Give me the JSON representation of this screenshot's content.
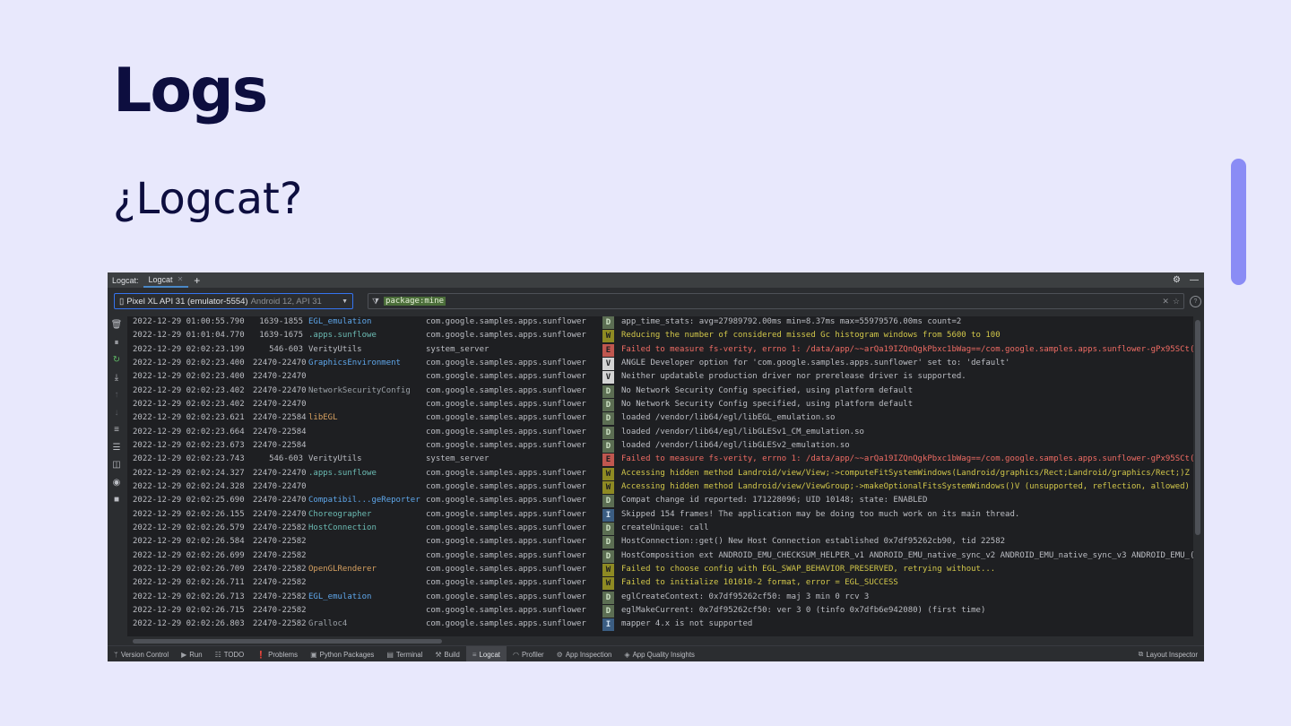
{
  "slide": {
    "title": "Logs",
    "subtitle": "¿Logcat?"
  },
  "ide": {
    "tabbar": {
      "label": "Logcat:",
      "tab": "Logcat",
      "add": "+",
      "settings_icon": "gear-icon",
      "minimize_icon": "minimize-icon"
    },
    "device": {
      "name": "Pixel XL API 31 (emulator-5554)",
      "detail": "Android 12, API 31"
    },
    "filter": {
      "query": "package:mine"
    },
    "side_toolbar": [
      {
        "name": "clear-logcat-icon",
        "glyph": "🗑"
      },
      {
        "name": "pause-icon",
        "glyph": "⏸"
      },
      {
        "name": "restart-icon",
        "glyph": "↻"
      },
      {
        "name": "scroll-to-end-icon",
        "glyph": "⤓"
      },
      {
        "name": "previous-occurrence-icon",
        "glyph": "↑"
      },
      {
        "name": "next-occurrence-icon",
        "glyph": "↓"
      },
      {
        "name": "soft-wrap-icon",
        "glyph": "≡"
      },
      {
        "name": "configure-view-icon",
        "glyph": "☰"
      },
      {
        "name": "split-panels-icon",
        "glyph": "◫"
      },
      {
        "name": "screenshot-icon",
        "glyph": "◉"
      },
      {
        "name": "screen-record-icon",
        "glyph": "■"
      }
    ],
    "log_rows": [
      {
        "time": "2022-12-29 01:00:55.790",
        "pid": "1639-1855",
        "tag": "EGL_emulation",
        "tag_style": "blue",
        "pkg": "com.google.samples.apps.sunflower",
        "level": "D",
        "msg": "app_time_stats: avg=27989792.00ms min=8.37ms max=55979576.00ms count=2"
      },
      {
        "time": "2022-12-29 01:01:04.770",
        "pid": "1639-1675",
        "tag": ".apps.sunflowe",
        "tag_style": "teal",
        "pkg": "com.google.samples.apps.sunflower",
        "level": "W",
        "msg": "Reducing the number of considered missed Gc histogram windows from 5600 to 100"
      },
      {
        "time": "2022-12-29 02:02:23.199",
        "pid": "546-603",
        "tag": "VerityUtils",
        "tag_style": "plain",
        "pkg": "system_server",
        "level": "E",
        "msg": "Failed to measure fs-verity, errno 1: /data/app/~~arQa19IZQnQgkPbxc1bWag==/com.google.samples.apps.sunflower-gPx95SCt("
      },
      {
        "time": "2022-12-29 02:02:23.400",
        "pid": "22470-22470",
        "tag": "GraphicsEnvironment",
        "tag_style": "blue",
        "pkg": "com.google.samples.apps.sunflower",
        "level": "V",
        "msg": "ANGLE Developer option for 'com.google.samples.apps.sunflower' set to: 'default'"
      },
      {
        "time": "2022-12-29 02:02:23.400",
        "pid": "22470-22470",
        "tag": "",
        "tag_style": "plain",
        "pkg": "com.google.samples.apps.sunflower",
        "level": "V",
        "msg": "Neither updatable production driver nor prerelease driver is supported."
      },
      {
        "time": "2022-12-29 02:02:23.402",
        "pid": "22470-22470",
        "tag": "NetworkSecurityConfig",
        "tag_style": "gray",
        "pkg": "com.google.samples.apps.sunflower",
        "level": "D",
        "msg": "No Network Security Config specified, using platform default"
      },
      {
        "time": "2022-12-29 02:02:23.402",
        "pid": "22470-22470",
        "tag": "",
        "tag_style": "plain",
        "pkg": "com.google.samples.apps.sunflower",
        "level": "D",
        "msg": "No Network Security Config specified, using platform default"
      },
      {
        "time": "2022-12-29 02:02:23.621",
        "pid": "22470-22584",
        "tag": "libEGL",
        "tag_style": "orange",
        "pkg": "com.google.samples.apps.sunflower",
        "level": "D",
        "msg": "loaded /vendor/lib64/egl/libEGL_emulation.so"
      },
      {
        "time": "2022-12-29 02:02:23.664",
        "pid": "22470-22584",
        "tag": "",
        "tag_style": "plain",
        "pkg": "com.google.samples.apps.sunflower",
        "level": "D",
        "msg": "loaded /vendor/lib64/egl/libGLESv1_CM_emulation.so"
      },
      {
        "time": "2022-12-29 02:02:23.673",
        "pid": "22470-22584",
        "tag": "",
        "tag_style": "plain",
        "pkg": "com.google.samples.apps.sunflower",
        "level": "D",
        "msg": "loaded /vendor/lib64/egl/libGLESv2_emulation.so"
      },
      {
        "time": "2022-12-29 02:02:23.743",
        "pid": "546-603",
        "tag": "VerityUtils",
        "tag_style": "plain",
        "pkg": "system_server",
        "level": "E",
        "msg": "Failed to measure fs-verity, errno 1: /data/app/~~arQa19IZQnQgkPbxc1bWag==/com.google.samples.apps.sunflower-gPx95SCt("
      },
      {
        "time": "2022-12-29 02:02:24.327",
        "pid": "22470-22470",
        "tag": ".apps.sunflowe",
        "tag_style": "teal",
        "pkg": "com.google.samples.apps.sunflower",
        "level": "W",
        "msg": "Accessing hidden method Landroid/view/View;->computeFitSystemWindows(Landroid/graphics/Rect;Landroid/graphics/Rect;)Z"
      },
      {
        "time": "2022-12-29 02:02:24.328",
        "pid": "22470-22470",
        "tag": "",
        "tag_style": "plain",
        "pkg": "com.google.samples.apps.sunflower",
        "level": "W",
        "msg": "Accessing hidden method Landroid/view/ViewGroup;->makeOptionalFitsSystemWindows()V (unsupported, reflection, allowed)"
      },
      {
        "time": "2022-12-29 02:02:25.690",
        "pid": "22470-22470",
        "tag": "Compatibil...geReporter",
        "tag_style": "blue",
        "pkg": "com.google.samples.apps.sunflower",
        "level": "D",
        "msg": "Compat change id reported: 171228096; UID 10148; state: ENABLED"
      },
      {
        "time": "2022-12-29 02:02:26.155",
        "pid": "22470-22470",
        "tag": "Choreographer",
        "tag_style": "teal",
        "pkg": "com.google.samples.apps.sunflower",
        "level": "I",
        "msg": "Skipped 154 frames!  The application may be doing too much work on its main thread."
      },
      {
        "time": "2022-12-29 02:02:26.579",
        "pid": "22470-22582",
        "tag": "HostConnection",
        "tag_style": "teal",
        "pkg": "com.google.samples.apps.sunflower",
        "level": "D",
        "msg": "createUnique: call"
      },
      {
        "time": "2022-12-29 02:02:26.584",
        "pid": "22470-22582",
        "tag": "",
        "tag_style": "plain",
        "pkg": "com.google.samples.apps.sunflower",
        "level": "D",
        "msg": "HostConnection::get() New Host Connection established 0x7df95262cb90, tid 22582"
      },
      {
        "time": "2022-12-29 02:02:26.699",
        "pid": "22470-22582",
        "tag": "",
        "tag_style": "plain",
        "pkg": "com.google.samples.apps.sunflower",
        "level": "D",
        "msg": "HostComposition ext ANDROID_EMU_CHECKSUM_HELPER_v1 ANDROID_EMU_native_sync_v2 ANDROID_EMU_native_sync_v3 ANDROID_EMU_("
      },
      {
        "time": "2022-12-29 02:02:26.709",
        "pid": "22470-22582",
        "tag": "OpenGLRenderer",
        "tag_style": "orange",
        "pkg": "com.google.samples.apps.sunflower",
        "level": "W",
        "msg": "Failed to choose config with EGL_SWAP_BEHAVIOR_PRESERVED, retrying without..."
      },
      {
        "time": "2022-12-29 02:02:26.711",
        "pid": "22470-22582",
        "tag": "",
        "tag_style": "plain",
        "pkg": "com.google.samples.apps.sunflower",
        "level": "W",
        "msg": "Failed to initialize 101010-2 format, error = EGL_SUCCESS"
      },
      {
        "time": "2022-12-29 02:02:26.713",
        "pid": "22470-22582",
        "tag": "EGL_emulation",
        "tag_style": "blue",
        "pkg": "com.google.samples.apps.sunflower",
        "level": "D",
        "msg": "eglCreateContext: 0x7df95262cf50: maj 3 min 0 rcv 3"
      },
      {
        "time": "2022-12-29 02:02:26.715",
        "pid": "22470-22582",
        "tag": "",
        "tag_style": "plain",
        "pkg": "com.google.samples.apps.sunflower",
        "level": "D",
        "msg": "eglMakeCurrent: 0x7df95262cf50: ver 3 0 (tinfo 0x7dfb6e942080) (first time)"
      },
      {
        "time": "2022-12-29 02:02:26.803",
        "pid": "22470-22582",
        "tag": "Gralloc4",
        "tag_style": "gray",
        "pkg": "com.google.samples.apps.sunflower",
        "level": "I",
        "msg": "mapper 4.x is not supported"
      }
    ],
    "statusbar": [
      {
        "label": "Version Control",
        "icon": "branch-icon",
        "glyph": "ᛘ",
        "active": false
      },
      {
        "label": "Run",
        "icon": "run-icon",
        "glyph": "▶",
        "active": false
      },
      {
        "label": "TODO",
        "icon": "todo-icon",
        "glyph": "☷",
        "active": false
      },
      {
        "label": "Problems",
        "icon": "problems-icon",
        "glyph": "❗",
        "active": false
      },
      {
        "label": "Python Packages",
        "icon": "packages-icon",
        "glyph": "▣",
        "active": false
      },
      {
        "label": "Terminal",
        "icon": "terminal-icon",
        "glyph": "▤",
        "active": false
      },
      {
        "label": "Build",
        "icon": "build-icon",
        "glyph": "⚒",
        "active": false
      },
      {
        "label": "Logcat",
        "icon": "logcat-icon",
        "glyph": "≡",
        "active": true
      },
      {
        "label": "Profiler",
        "icon": "profiler-icon",
        "glyph": "◠",
        "active": false
      },
      {
        "label": "App Inspection",
        "icon": "app-inspection-icon",
        "glyph": "⚙",
        "active": false
      },
      {
        "label": "App Quality Insights",
        "icon": "app-quality-icon",
        "glyph": "◈",
        "active": false
      }
    ],
    "statusbar_right": {
      "label": "Layout Inspector",
      "icon": "layout-inspector-icon",
      "glyph": "⧉"
    }
  }
}
